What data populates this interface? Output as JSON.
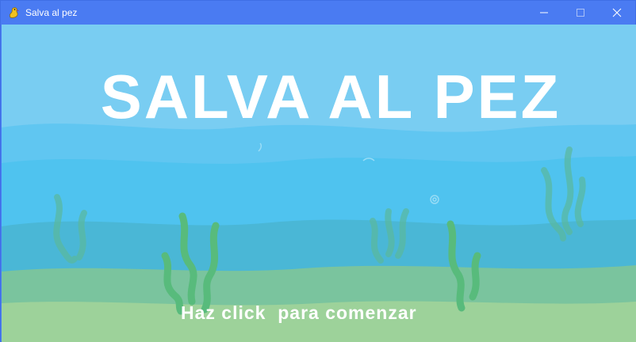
{
  "window": {
    "title": "Salva al pez",
    "icon": "pygame-snake-icon",
    "controls": [
      "minimize-icon",
      "maximize-icon",
      "close-icon"
    ]
  },
  "game": {
    "title": "SALVA AL PEZ",
    "start_prompt": "Haz click  para comenzar"
  },
  "colors": {
    "titlebar": "#4a7bf2",
    "sky_water": "#79cdf2",
    "mid_water": "#4fc3ef",
    "deep_water": "#4ab7d6",
    "sea_floor_dark": "#7ac49e",
    "sea_floor_light": "#9dd29a",
    "seaweed": "#58bb7c",
    "text": "#ffffff"
  }
}
